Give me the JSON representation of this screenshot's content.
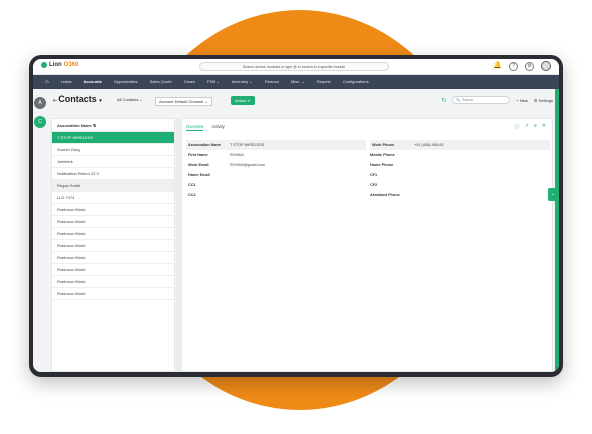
{
  "topbar": {
    "logo_prefix": "Lion",
    "logo_suffix": "O360",
    "search_placeholder": "Search across modules or type @ to search in a specific module"
  },
  "nav": {
    "items": [
      "Leads",
      "Accounts",
      "Opportunities",
      "Sales Quote",
      "Cases",
      "FSM ⌄",
      "Inventory ⌄",
      "Finance",
      "Misc. ⌄",
      "Reports",
      "Configurations"
    ],
    "active_index": 1
  },
  "rail": {
    "a_label": "A",
    "c_label": "C"
  },
  "page_header": {
    "title": "Contacts",
    "filter_all": "All Contacts",
    "channel": "Account Default Channel",
    "action_label": "Action",
    "search_placeholder": "Search",
    "new_label": "+ New",
    "settings_label": "Settings"
  },
  "list": {
    "header": "Association Name",
    "items": [
      "T STOP WIRELESS",
      "Suresh Garg",
      "Jwhirlerk",
      "Notification Return 22 0",
      "Regan Smith",
      "LLD 7474",
      "Robinson World",
      "Robinson World",
      "Robinson World",
      "Robinson World",
      "Robinson World",
      "Robinson World",
      "Robinson World",
      "Robinson World"
    ],
    "selected_index": 0,
    "highlight_index": 4
  },
  "detail": {
    "tabs": [
      "Overview",
      "Activity"
    ],
    "fields": [
      {
        "l_label": "Association Name",
        "l_value": "T STOP WIRELESS",
        "r_label": "Work Phone",
        "r_value": "+91 (406)-965-65"
      },
      {
        "l_label": "First Name",
        "l_value": "ROHAN",
        "r_label": "Mobile Phone",
        "r_value": ""
      },
      {
        "l_label": "Work Email",
        "l_value": "ROHAN@gmail.com",
        "r_label": "Home Phone",
        "r_value": ""
      },
      {
        "l_label": "Home Email",
        "l_value": "",
        "r_label": "CF1",
        "r_value": ""
      },
      {
        "l_label": "CC1",
        "l_value": "",
        "r_label": "CF2",
        "r_value": ""
      },
      {
        "l_label": "CC2",
        "l_value": "",
        "r_label": "Assistant Phone",
        "r_value": ""
      }
    ]
  },
  "colors": {
    "accent": "#1fae73",
    "nav_bg": "#3b4556",
    "blob": "#ef8a17"
  }
}
